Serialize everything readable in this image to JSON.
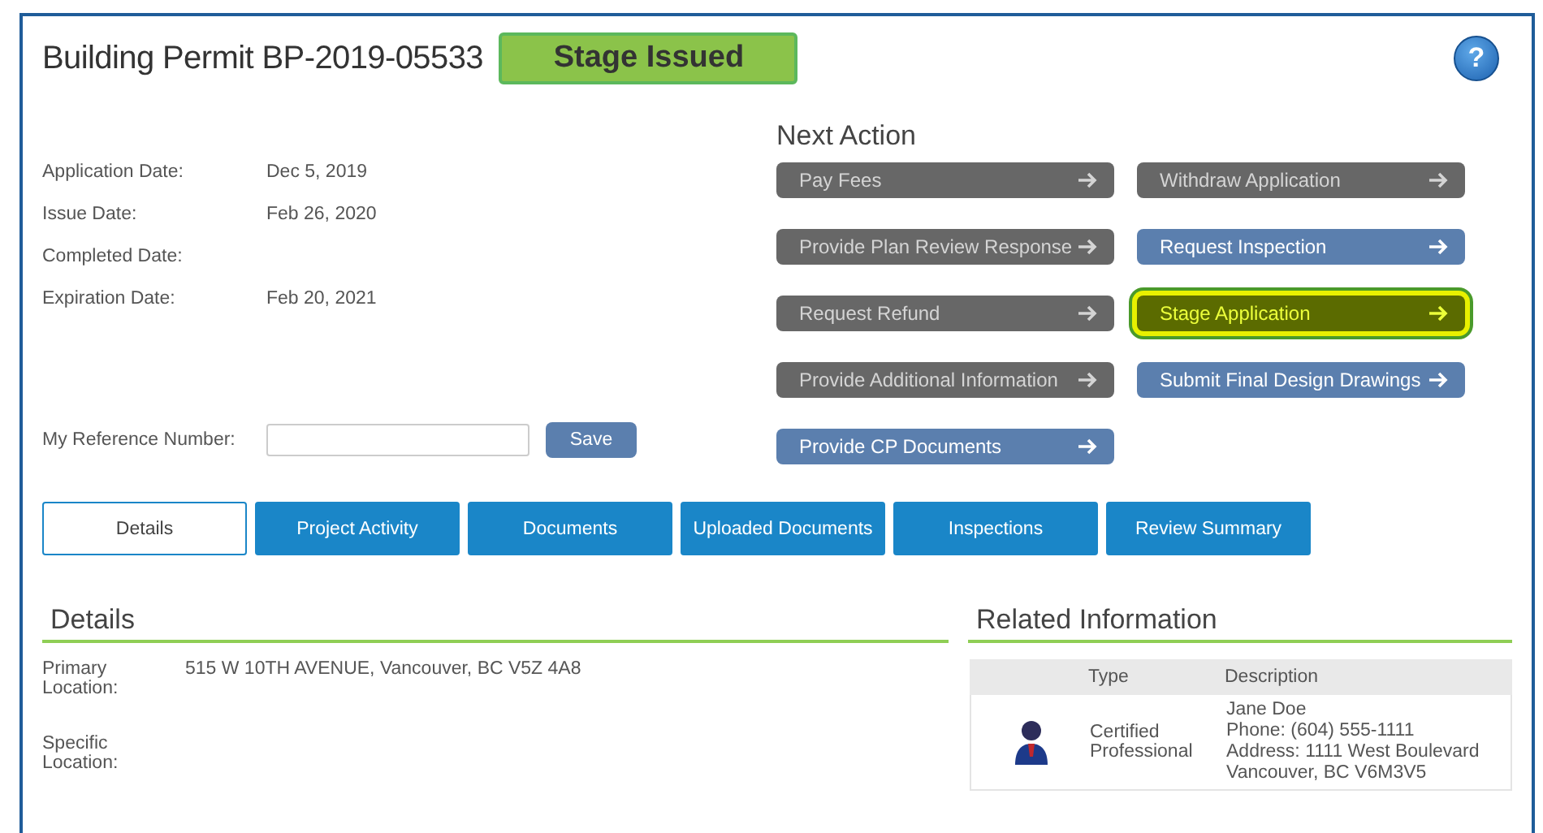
{
  "title": "Building Permit BP-2019-05533",
  "status_badge": "Stage Issued",
  "help": "?",
  "dates": [
    {
      "label": "Application Date:",
      "value": "Dec 5, 2019"
    },
    {
      "label": "Issue Date:",
      "value": "Feb 26, 2020"
    },
    {
      "label": "Completed Date:"
    },
    {
      "label": "Expiration Date:",
      "value": "Feb 20, 2021"
    }
  ],
  "reference": {
    "label": "My Reference Number:",
    "button": "Save"
  },
  "next_action": {
    "title": "Next Action",
    "columns": [
      [
        {
          "label": "Pay Fees",
          "kind": "disabled"
        },
        {
          "label": "Provide Plan Review Response",
          "kind": "disabled"
        },
        {
          "label": "Request Refund",
          "kind": "disabled"
        },
        {
          "label": "Provide Additional Information",
          "kind": "disabled"
        },
        {
          "label": "Provide CP Documents",
          "kind": "active"
        }
      ],
      [
        {
          "label": "Withdraw Application",
          "kind": "disabled"
        },
        {
          "label": "Request Inspection",
          "kind": "active"
        },
        {
          "label": "Stage Application",
          "kind": "highlighted"
        },
        {
          "label": "Submit Final Design Drawings",
          "kind": "active"
        }
      ]
    ]
  },
  "tabs": [
    {
      "label": "Details",
      "selected": true
    },
    {
      "label": "Project Activity",
      "selected": false
    },
    {
      "label": "Documents",
      "selected": false
    },
    {
      "label": "Uploaded Documents",
      "selected": false
    },
    {
      "label": "Inspections",
      "selected": false
    },
    {
      "label": "Review Summary",
      "selected": false
    }
  ],
  "details": {
    "title": "Details",
    "rows": [
      {
        "label": "Primary Location:",
        "value": "515 W 10TH AVENUE, Vancouver, BC V5Z 4A8"
      },
      {
        "label": "Specific Location:"
      }
    ]
  },
  "related": {
    "title": "Related Information",
    "columns": [
      "Type",
      "Description"
    ],
    "rows": [
      {
        "type": "Certified Professional",
        "description": [
          "Jane Doe",
          "Phone: (604) 555-1111",
          "Address: 1111 West Boulevard",
          "Vancouver, BC V6M3V5"
        ]
      }
    ]
  }
}
